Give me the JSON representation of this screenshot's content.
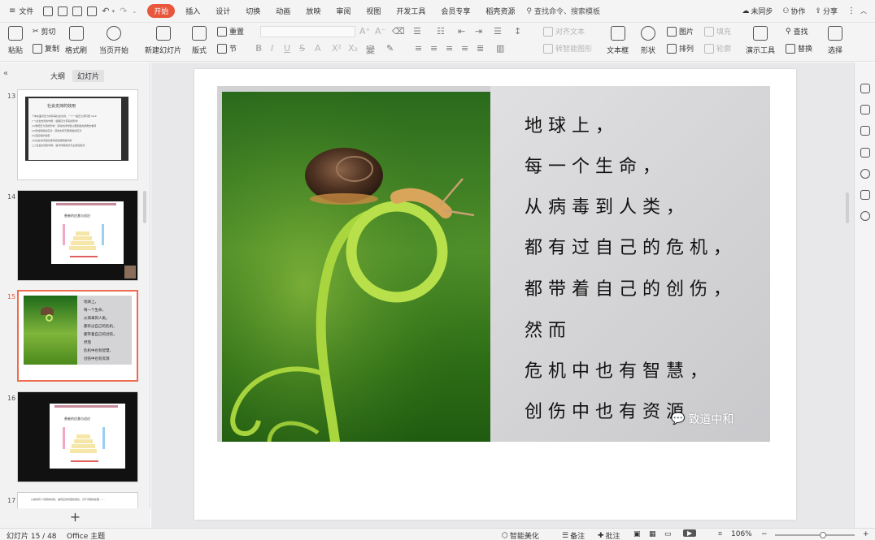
{
  "menubar": {
    "file": "文件",
    "tabs": [
      "开始",
      "插入",
      "设计",
      "切换",
      "动画",
      "放映",
      "审阅",
      "视图",
      "开发工具",
      "会员专享",
      "稻壳资源"
    ],
    "active_tab": "开始",
    "search_placeholder": "查找命令、搜索模板",
    "right": [
      "未同步",
      "协作",
      "分享"
    ]
  },
  "ribbon": {
    "paste": "粘贴",
    "cut": "剪切",
    "copy": "复制",
    "format_painter": "格式刷",
    "play_from_current": "当页开始",
    "new_slide": "新建幻灯片",
    "layout": "版式",
    "section": "节",
    "reset": "重置",
    "align_text": "对齐文本",
    "convert_smartart": "转智能图形",
    "textbox": "文本框",
    "shape": "形状",
    "arrange": "排列",
    "picture": "图片",
    "fill": "填充",
    "outline": "轮廓",
    "presenter_tools": "演示工具",
    "find": "查找",
    "replace": "替换",
    "select": "选择"
  },
  "leftpanel": {
    "tab_outline": "大纲",
    "tab_slides": "幻灯片",
    "slide_numbers": [
      "13",
      "14",
      "15",
      "16",
      "17"
    ],
    "current": "15",
    "thumb13": {
      "title": "社会支持的效用",
      "lines": [
        "个体在面对压力时获得社会支持，一个一般压力源可能 Verb",
        "(一)社会支持的作用：缓解压力带来的影响",
        "(1)降低压力源的影响：获得支持时能从更积极的视角去看待",
        "(2)增加积极的应对：获得支持可更积极的应对",
        "(3)直接保护健康",
        "(4)社会支持直接或间接的起积极作用",
        "(二)社会支持的作用：缓冲作用模式与主效应模式"
      ]
    },
    "thumb14": {
      "title": "患者的应激与适应"
    },
    "thumb15": {
      "lines": [
        "地球上，",
        "每一个生命，",
        "从病毒到人类，",
        "都有过自己的危机，",
        "都带着自己的创伤，",
        "然而",
        "危机中也有智慧，",
        "创伤中也有资源"
      ]
    },
    "thumb16": {
      "title": "患者的应激与适应"
    },
    "thumb17": {
      "text": "从前你有个问题的时候，遇到应激问题的变化，对于问题的处理 ……"
    },
    "add_slide": "+"
  },
  "slide": {
    "poem": [
      "地球上，",
      "每一个生命，",
      "从病毒到人类，",
      "都有过自己的危机，",
      "都带着自己的创伤，",
      "然而",
      "危机中也有智慧，",
      "创伤中也有资源"
    ],
    "watermark": "致道中和"
  },
  "statusbar": {
    "slide_info": "幻灯片 15 / 48",
    "theme": "Office 主题",
    "beautify": "智能美化",
    "notes": "备注",
    "comments": "批注",
    "zoom": "106%",
    "zoom_level": 0.6,
    "plus": "+",
    "minus": "−"
  }
}
